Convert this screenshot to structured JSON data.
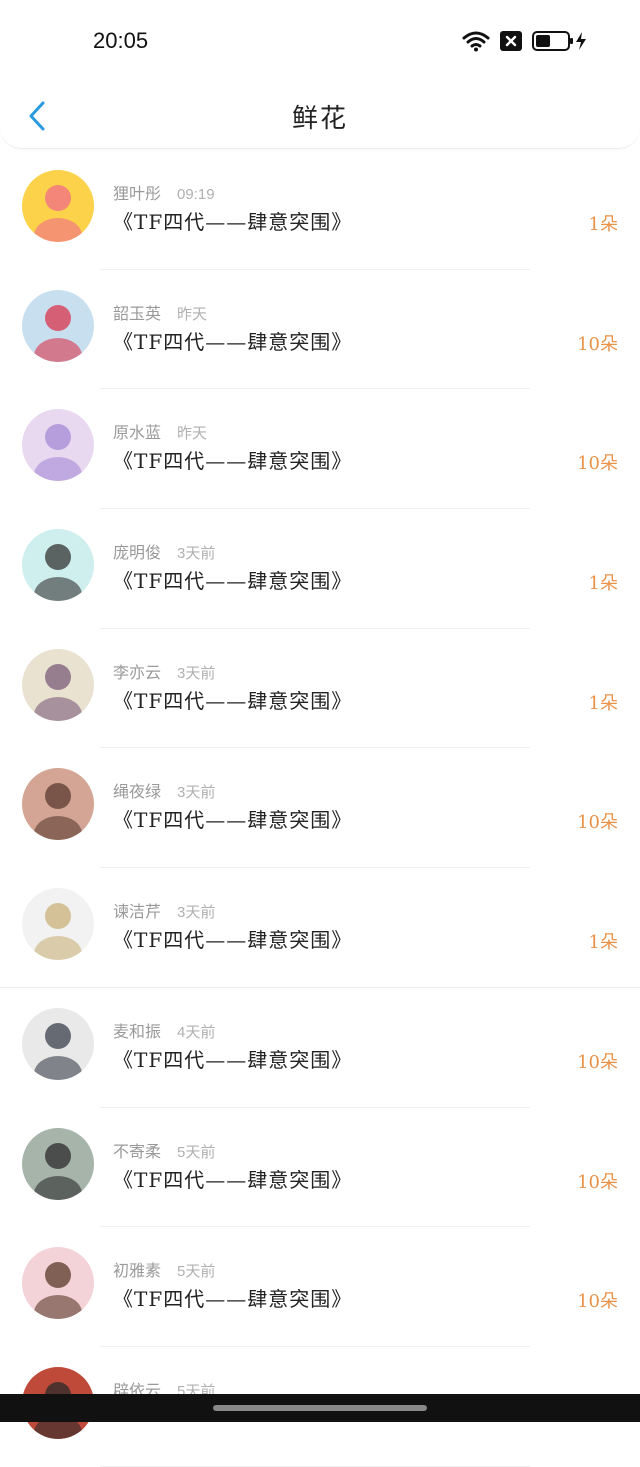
{
  "status": {
    "time": "20:05"
  },
  "header": {
    "title": "鲜花"
  },
  "items": [
    {
      "name": "狸叶彤",
      "time": "09:19",
      "content": "《TF四代——肆意突围》",
      "amount": "1朵",
      "colors": [
        "#fbd24a",
        "#f06b8a"
      ]
    },
    {
      "name": "韶玉英",
      "time": "昨天",
      "content": "《TF四代——肆意突围》",
      "amount": "10朵",
      "colors": [
        "#c8dff0",
        "#d9364c"
      ]
    },
    {
      "name": "原水蓝",
      "time": "昨天",
      "content": "《TF四代——肆意突围》",
      "amount": "10朵",
      "colors": [
        "#e8d8f0",
        "#a58bd6"
      ]
    },
    {
      "name": "庞明俊",
      "time": "3天前",
      "content": "《TF四代——肆意突围》",
      "amount": "1朵",
      "colors": [
        "#cfeeee",
        "#333"
      ]
    },
    {
      "name": "李亦云",
      "time": "3天前",
      "content": "《TF四代——肆意突围》",
      "amount": "1朵",
      "colors": [
        "#e9e2d0",
        "#7a5c7a"
      ]
    },
    {
      "name": "绳夜绿",
      "time": "3天前",
      "content": "《TF四代——肆意突围》",
      "amount": "10朵",
      "colors": [
        "#d4a594",
        "#5a3a30"
      ]
    },
    {
      "name": "谏洁芹",
      "time": "3天前",
      "content": "《TF四代——肆意突围》",
      "amount": "1朵",
      "colors": [
        "#f2f2f2",
        "#c9b07a"
      ]
    },
    {
      "name": "麦和振",
      "time": "4天前",
      "content": "《TF四代——肆意突围》",
      "amount": "10朵",
      "colors": [
        "#e9e9e9",
        "#3a3f4a"
      ]
    },
    {
      "name": "不寄柔",
      "time": "5天前",
      "content": "《TF四代——肆意突围》",
      "amount": "10朵",
      "colors": [
        "#a6b4aa",
        "#2b2b2b"
      ]
    },
    {
      "name": "初雅素",
      "time": "5天前",
      "content": "《TF四代——肆意突围》",
      "amount": "10朵",
      "colors": [
        "#f3d2d8",
        "#5a3a2a"
      ]
    },
    {
      "name": "辟依云",
      "time": "5天前",
      "content": "",
      "amount": "",
      "colors": [
        "#c04a3a",
        "#2a2a2a"
      ]
    }
  ]
}
